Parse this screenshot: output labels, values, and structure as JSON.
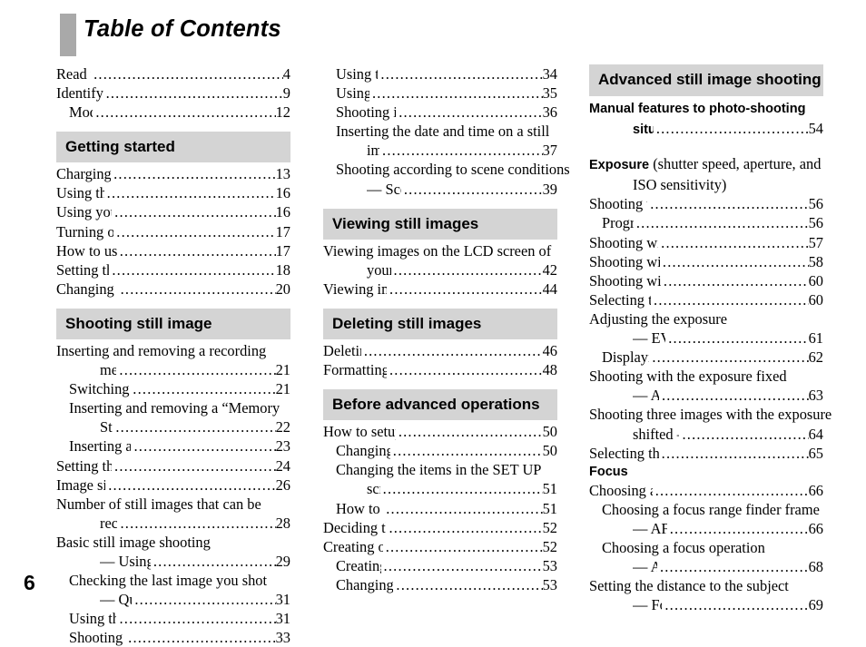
{
  "page": {
    "title": "Table of Contents",
    "folio": "6",
    "accent_gray": "#d4d4d4",
    "title_block_gray": "#a9a9a9"
  },
  "columns": [
    {
      "id": "col-1",
      "blocks": [
        {
          "type": "entries",
          "items": [
            {
              "label": "Read this first",
              "page": "4",
              "level": 0
            },
            {
              "label": "Identifying the parts",
              "page": "9",
              "level": 0
            },
            {
              "label": "Mode dial",
              "page": "12",
              "level": 1
            }
          ]
        },
        {
          "type": "section",
          "title": "Getting started",
          "spaced": true
        },
        {
          "type": "entries",
          "items": [
            {
              "label": "Charging the battery pack",
              "page": "13",
              "level": 0
            },
            {
              "label": "Using the AC adaptor",
              "page": "16",
              "level": 0
            },
            {
              "label": "Using your camera abroad",
              "page": "16",
              "level": 0
            },
            {
              "label": "Turning on/off your camera",
              "page": "17",
              "level": 0
            },
            {
              "label": "How to use the control button",
              "page": "17",
              "level": 0
            },
            {
              "label": "Setting the date and time",
              "page": "18",
              "level": 0
            },
            {
              "label": "Changing the language setting",
              "page": "20",
              "level": 0
            }
          ]
        },
        {
          "type": "section",
          "title": "Shooting still image",
          "spaced": true
        },
        {
          "type": "entries",
          "items": [
            {
              "label": "Inserting and removing a recording",
              "page": "",
              "level": 0
            },
            {
              "label": "medium",
              "page": "21",
              "level": 2
            },
            {
              "label": "Switching the recording medium",
              "page": "21",
              "level": 1
            },
            {
              "label": "Inserting and removing a “Memory",
              "page": "",
              "level": 1
            },
            {
              "label": "Stick”",
              "page": "22",
              "level": 2
            },
            {
              "label": "Inserting and removing a CF card",
              "page": "23",
              "level": 1
            },
            {
              "label": "Setting the still image size",
              "page": "24",
              "level": 0
            },
            {
              "label": "Image size and quality",
              "page": "26",
              "level": 0
            },
            {
              "label": "Number of still images that can be",
              "page": "",
              "level": 0
            },
            {
              "label": "recorded",
              "page": "28",
              "level": 2
            },
            {
              "label": "Basic still image shooting",
              "page": "",
              "level": 0
            },
            {
              "label": "— Using auto adjustment mode",
              "page": "29",
              "level": 2
            },
            {
              "label": "Checking the last image you shot",
              "page": "",
              "level": 1
            },
            {
              "label": "— Quick Review",
              "page": "31",
              "level": 2
            },
            {
              "label": "Using the zoom feature",
              "page": "31",
              "level": 1
            },
            {
              "label": "Shooting close-ups — Macro",
              "page": "33",
              "level": 1
            }
          ]
        }
      ]
    },
    {
      "id": "col-2",
      "blocks": [
        {
          "type": "entries",
          "items": [
            {
              "label": "Using the self-timer",
              "page": "34",
              "level": 1
            },
            {
              "label": "Using the flash",
              "page": "35",
              "level": 1
            },
            {
              "label": "Shooting images with the finder",
              "page": "36",
              "level": 1
            },
            {
              "label": "Inserting the date and time on a still",
              "page": "",
              "level": 1
            },
            {
              "label": "image",
              "page": "37",
              "level": 2
            },
            {
              "label": "Shooting according to scene conditions",
              "page": "",
              "level": 1
            },
            {
              "label": "— Scene Selection",
              "page": "39",
              "level": 2
            }
          ]
        },
        {
          "type": "section",
          "title": "Viewing still images",
          "spaced": true
        },
        {
          "type": "entries",
          "items": [
            {
              "label": "Viewing images on the LCD screen of",
              "page": "",
              "level": 0
            },
            {
              "label": "your camera",
              "page": "42",
              "level": 2
            },
            {
              "label": "Viewing images on a TV screen",
              "page": "44",
              "level": 0
            }
          ]
        },
        {
          "type": "section",
          "title": "Deleting still images",
          "spaced": true
        },
        {
          "type": "entries",
          "items": [
            {
              "label": "Deleting images",
              "page": "46",
              "level": 0
            },
            {
              "label": "Formatting a recording medium",
              "page": "48",
              "level": 0
            }
          ]
        },
        {
          "type": "section",
          "title": "Before advanced operations",
          "spaced": true
        },
        {
          "type": "entries",
          "items": [
            {
              "label": "How to setup and operate your camera",
              "page": "50",
              "level": 0
            },
            {
              "label": "Changing the menu settings",
              "page": "50",
              "level": 1
            },
            {
              "label": "Changing the items in the SET UP",
              "page": "",
              "level": 1
            },
            {
              "label": "screen",
              "page": "51",
              "level": 2
            },
            {
              "label": "How to use the jog dial",
              "page": "51",
              "level": 1
            },
            {
              "label": "Deciding the still image quality",
              "page": "52",
              "level": 0
            },
            {
              "label": "Creating or selecting a folder",
              "page": "52",
              "level": 0
            },
            {
              "label": "Creating a new folder",
              "page": "53",
              "level": 1
            },
            {
              "label": "Changing the recording folder",
              "page": "53",
              "level": 1
            }
          ]
        }
      ]
    },
    {
      "id": "col-3",
      "blocks": [
        {
          "type": "section",
          "title": "Advanced still image shooting",
          "spaced": false,
          "twoLine": true
        },
        {
          "type": "entries",
          "items": [
            {
              "label": "Manual features to photo-shooting",
              "page": "",
              "level": 0,
              "style": "bold-sans"
            },
            {
              "label": "situations",
              "page": "54",
              "level": 2,
              "style": "bold-sans"
            }
          ]
        },
        {
          "type": "gap"
        },
        {
          "type": "mixed",
          "bold": "Exposure",
          "rest": " (shutter speed, aperture, and"
        },
        {
          "type": "entries",
          "items": [
            {
              "label": "ISO sensitivity)",
              "page": "",
              "level": 2
            },
            {
              "label": "Shooting with Program auto",
              "page": "56",
              "level": 0
            },
            {
              "label": "Program Shift",
              "page": "56",
              "level": 1
            },
            {
              "label": "Shooting with shutter speed priority",
              "page": "57",
              "level": 0
            },
            {
              "label": "Shooting with aperture priority mode",
              "page": "58",
              "level": 0
            },
            {
              "label": "Shooting with manual exposure mode",
              "page": "60",
              "level": 0
            },
            {
              "label": "Selecting the metering method",
              "page": "60",
              "level": 0
            },
            {
              "label": "Adjusting the exposure",
              "page": "",
              "level": 0
            },
            {
              "label": "— EV adjustment",
              "page": "61",
              "level": 2
            },
            {
              "label": "Displaying a histogram",
              "page": "62",
              "level": 1
            },
            {
              "label": "Shooting with the exposure fixed",
              "page": "",
              "level": 0
            },
            {
              "label": "— AE LOCK",
              "page": "63",
              "level": 2
            },
            {
              "label": "Shooting three images with the exposure",
              "page": "",
              "level": 0
            },
            {
              "label": "shifted — Exposure Bracket",
              "page": "64",
              "level": 2
            },
            {
              "label": "Selecting the ISO sensitivity — ISO",
              "page": "65",
              "level": 0
            }
          ]
        },
        {
          "type": "boldhead",
          "title": "Focus"
        },
        {
          "type": "entries",
          "items": [
            {
              "label": "Choosing an auto focus method",
              "page": "66",
              "level": 0
            },
            {
              "label": "Choosing a focus range finder frame",
              "page": "",
              "level": 1
            },
            {
              "label": "— AF range finder",
              "page": "66",
              "level": 2
            },
            {
              "label": "Choosing a focus operation",
              "page": "",
              "level": 1
            },
            {
              "label": "— AF Mode",
              "page": "68",
              "level": 2
            },
            {
              "label": "Setting the distance to the subject",
              "page": "",
              "level": 0
            },
            {
              "label": "— Focus preset",
              "page": "69",
              "level": 2
            }
          ]
        }
      ]
    }
  ]
}
